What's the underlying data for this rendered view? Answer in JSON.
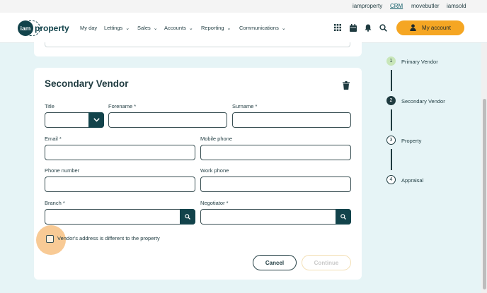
{
  "topbar": {
    "links": [
      "iamproperty",
      "CRM",
      "movebutler",
      "iamsold"
    ],
    "active": "CRM"
  },
  "nav": {
    "logo_badge": "iam",
    "logo_text": "property",
    "menu": [
      {
        "label": "My day",
        "dropdown": false
      },
      {
        "label": "Lettings",
        "dropdown": true
      },
      {
        "label": "Sales",
        "dropdown": true
      },
      {
        "label": "Accounts",
        "dropdown": true
      },
      {
        "label": "Reporting",
        "dropdown": true
      },
      {
        "label": "Communications",
        "dropdown": true
      }
    ],
    "icons": [
      "grid-icon",
      "calendar-icon",
      "bell-icon",
      "search-icon"
    ],
    "account_label": "My account"
  },
  "form": {
    "title": "Secondary Vendor",
    "fields": {
      "title": {
        "label": "Title",
        "value": ""
      },
      "forename": {
        "label": "Forename *",
        "value": ""
      },
      "surname": {
        "label": "Surname *",
        "value": ""
      },
      "email": {
        "label": "Email *",
        "value": ""
      },
      "mobile": {
        "label": "Mobile phone",
        "value": ""
      },
      "phone": {
        "label": "Phone number",
        "value": ""
      },
      "work": {
        "label": "Work phone",
        "value": ""
      },
      "branch": {
        "label": "Branch *",
        "value": ""
      },
      "negotiator": {
        "label": "Negotiator *",
        "value": ""
      }
    },
    "checkbox_label": "Vendor's address is different to the property",
    "cancel_label": "Cancel",
    "continue_label": "Continue"
  },
  "stepper": {
    "steps": [
      {
        "num": "1",
        "label": "Primary Vendor",
        "state": "complete"
      },
      {
        "num": "2",
        "label": "Secondary Vendor",
        "state": "current"
      },
      {
        "num": "3",
        "label": "Property",
        "state": "pending"
      },
      {
        "num": "4",
        "label": "Appraisal",
        "state": "pending"
      }
    ]
  },
  "colors": {
    "accent": "#f5a623",
    "primary": "#12434b",
    "background": "#e6f4f6",
    "step_complete": "#c8e6b9"
  }
}
